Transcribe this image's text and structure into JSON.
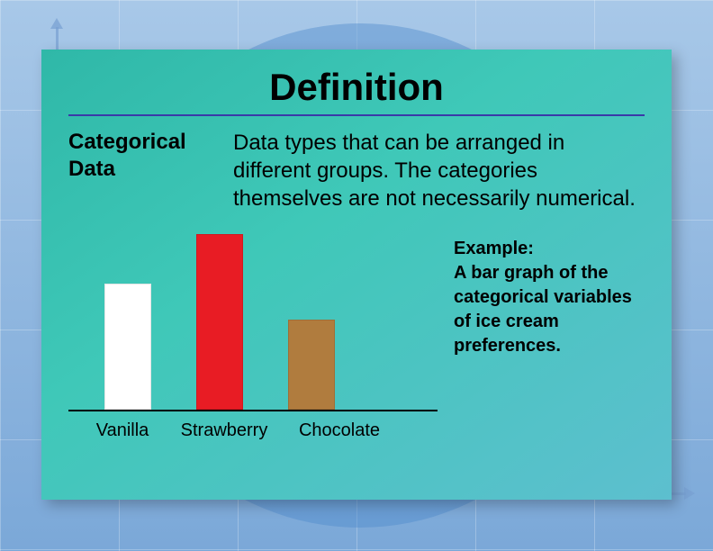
{
  "title": "Definition",
  "term": "Categorical Data",
  "description": "Data types that can be arranged in different groups. The categories themselves are not necessarily numerical.",
  "example": "Example:\nA bar graph of the categorical variables of ice cream preferences.",
  "chart_data": {
    "type": "bar",
    "title": "",
    "xlabel": "",
    "ylabel": "",
    "categories": [
      "Vanilla",
      "Strawberry",
      "Chocolate"
    ],
    "values": [
      140,
      195,
      100
    ],
    "colors": [
      "#ffffff",
      "#e81c24",
      "#b07c3e"
    ],
    "ylim": [
      0,
      200
    ]
  }
}
